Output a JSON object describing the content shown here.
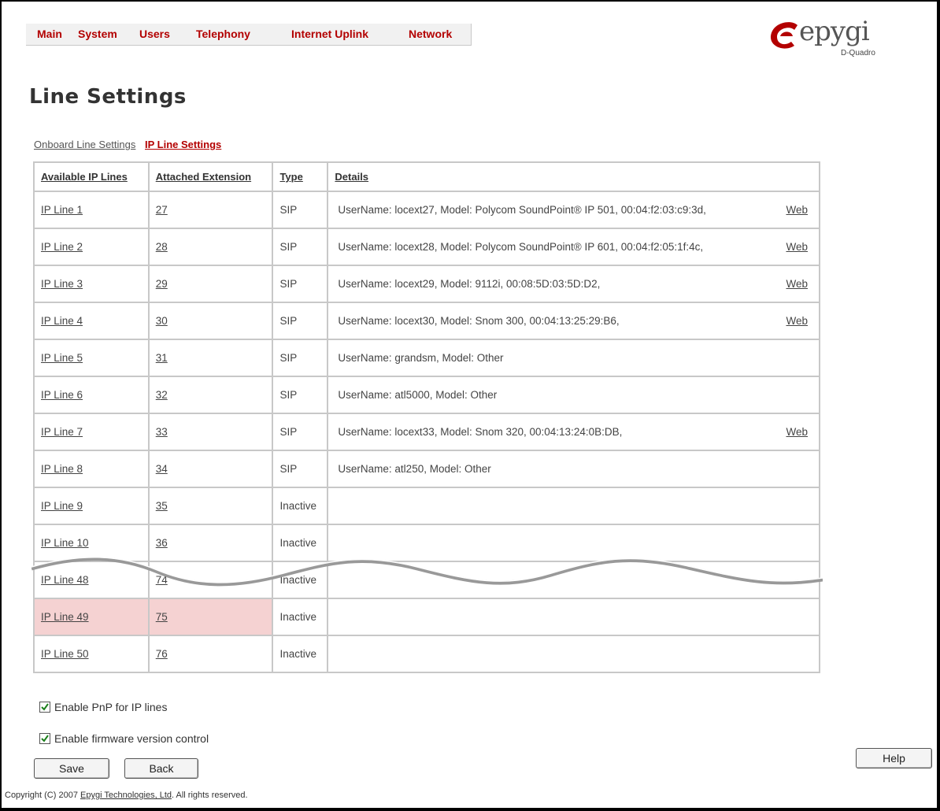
{
  "nav": {
    "items": [
      "Main",
      "System",
      "Users",
      "Telephony",
      "Internet Uplink",
      "Network"
    ]
  },
  "logo": {
    "text": "epygi",
    "sub": "D-Quadro"
  },
  "page_title": "Line Settings",
  "subtabs": {
    "onboard": "Onboard Line Settings",
    "ip": "IP Line Settings"
  },
  "table": {
    "headers": [
      "Available IP Lines",
      "Attached Extension",
      "Type",
      "Details"
    ],
    "rows": [
      {
        "line": "IP Line 1",
        "ext": "27",
        "type": "SIP",
        "details": "UserName: locext27, Model: Polycom SoundPoint® IP 501, 00:04:f2:03:c9:3d,",
        "web": "Web"
      },
      {
        "line": "IP Line 2",
        "ext": "28",
        "type": "SIP",
        "details": "UserName: locext28, Model: Polycom SoundPoint® IP 601, 00:04:f2:05:1f:4c,",
        "web": "Web"
      },
      {
        "line": "IP Line 3",
        "ext": "29",
        "type": "SIP",
        "details": "UserName: locext29, Model: 9112i, 00:08:5D:03:5D:D2,",
        "web": "Web"
      },
      {
        "line": "IP Line 4",
        "ext": "30",
        "type": "SIP",
        "details": "UserName: locext30, Model: Snom 300, 00:04:13:25:29:B6,",
        "web": "Web"
      },
      {
        "line": "IP Line 5",
        "ext": "31",
        "type": "SIP",
        "details": "UserName: grandsm, Model: Other",
        "web": ""
      },
      {
        "line": "IP Line 6",
        "ext": "32",
        "type": "SIP",
        "details": "UserName: atl5000, Model: Other",
        "web": ""
      },
      {
        "line": "IP Line 7",
        "ext": "33",
        "type": "SIP",
        "details": "UserName: locext33, Model: Snom 320, 00:04:13:24:0B:DB,",
        "web": "Web"
      },
      {
        "line": "IP Line 8",
        "ext": "34",
        "type": "SIP",
        "details": "UserName: atl250, Model: Other",
        "web": ""
      },
      {
        "line": "IP Line 9",
        "ext": "35",
        "type": "Inactive",
        "details": "",
        "web": ""
      },
      {
        "line": "IP Line 10",
        "ext": "36",
        "type": "Inactive",
        "details": "",
        "web": ""
      },
      {
        "line": "IP Line 48",
        "ext": "74",
        "type": "Inactive",
        "details": "",
        "web": ""
      },
      {
        "line": "IP Line 49",
        "ext": "75",
        "type": "Inactive",
        "details": "",
        "web": "",
        "highlight": true
      },
      {
        "line": "IP Line 50",
        "ext": "76",
        "type": "Inactive",
        "details": "",
        "web": ""
      }
    ]
  },
  "options": {
    "pnp_label": "Enable PnP for IP lines",
    "pnp_checked": true,
    "fw_label": "Enable firmware version control",
    "fw_checked": true
  },
  "buttons": {
    "save": "Save",
    "back": "Back",
    "help": "Help"
  },
  "footer": {
    "prefix": "Copyright (C) 2007",
    "link": "Epygi Technologies, Ltd",
    "suffix": ". All rights reserved."
  },
  "colors": {
    "accent": "#b30000",
    "highlight": "#f5d2d2"
  }
}
